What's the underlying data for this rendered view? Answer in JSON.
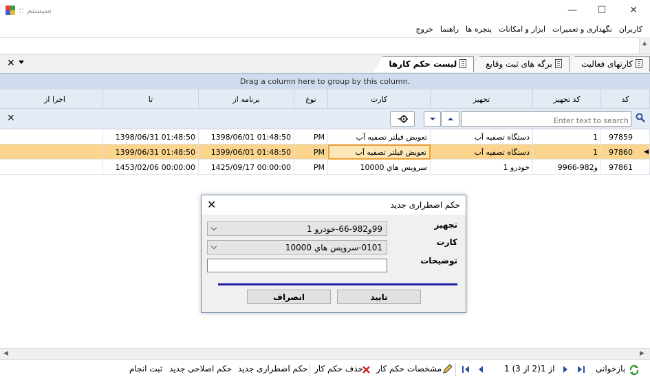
{
  "window": {
    "title": ":: سیستم",
    "minimize": "—",
    "maximize": "☐",
    "close": "✕"
  },
  "menu": [
    "کاربران",
    "نگهداری و تعمیرات",
    "ابزار و امکانات",
    "پنجره ها",
    "راهنما",
    "خروج"
  ],
  "tabs": [
    {
      "label": "کارتهای فعالیت"
    },
    {
      "label": "برگه های ثبت وقایع"
    },
    {
      "label": "لیست حکم کارها"
    }
  ],
  "tab_close": "✕",
  "group_panel": "Drag a column here to group by this column.",
  "columns": [
    "کد",
    "کد تجهیز",
    "تجهیز",
    "کارت",
    "نوع",
    "برنامه از",
    "تا",
    "اجرا از"
  ],
  "filter": {
    "placeholder": "Enter text to search",
    "clear": "✕"
  },
  "rows": [
    [
      "97859",
      "1",
      "دستگاه تصفیه آب",
      "تعویض فیلتر تصفیه آب",
      "PM",
      "1398/06/01 01:48:50",
      "1398/06/31 01:48:50",
      ""
    ],
    [
      "97860",
      "1",
      "دستگاه تصفیه آب",
      "تعویض فیلتر تصفیه آب",
      "PM",
      "1399/06/01 01:48:50",
      "1399/06/31 01:48:50",
      ""
    ],
    [
      "97861",
      "99و982-66",
      "خودرو 1",
      "سرویس هاي 10000",
      "PM",
      "1425/09/17 00:00:00",
      "1453/02/06 00:00:00",
      ""
    ]
  ],
  "selected_row_index": 1,
  "status": {
    "refresh": "بازخوانی",
    "page_info": "1 از 1(2 از 3)",
    "details": "مشخصات حکم کار",
    "delete": "حذف حکم کار",
    "new_emergency": "حکم اضطراری جدید",
    "new_corrective": "حکم اصلاحی جدید",
    "register": "ثبت انجام"
  },
  "dialog": {
    "title": "حکم اضطراری جدید",
    "close": "✕",
    "equipment_label": "تجهیز",
    "equipment_value": "99و982-66-خودرو 1",
    "card_label": "کارت",
    "card_value": "0101-سرويس هاي 10000",
    "notes_label": "توضیحات",
    "notes_value": "",
    "ok": "تایید",
    "cancel": "انصراف"
  },
  "colors": {
    "selected_row": "#fbd58e",
    "header_bg": "#e3ebf5",
    "group_bg": "#cfdced",
    "progress": "#1e1ea8"
  }
}
